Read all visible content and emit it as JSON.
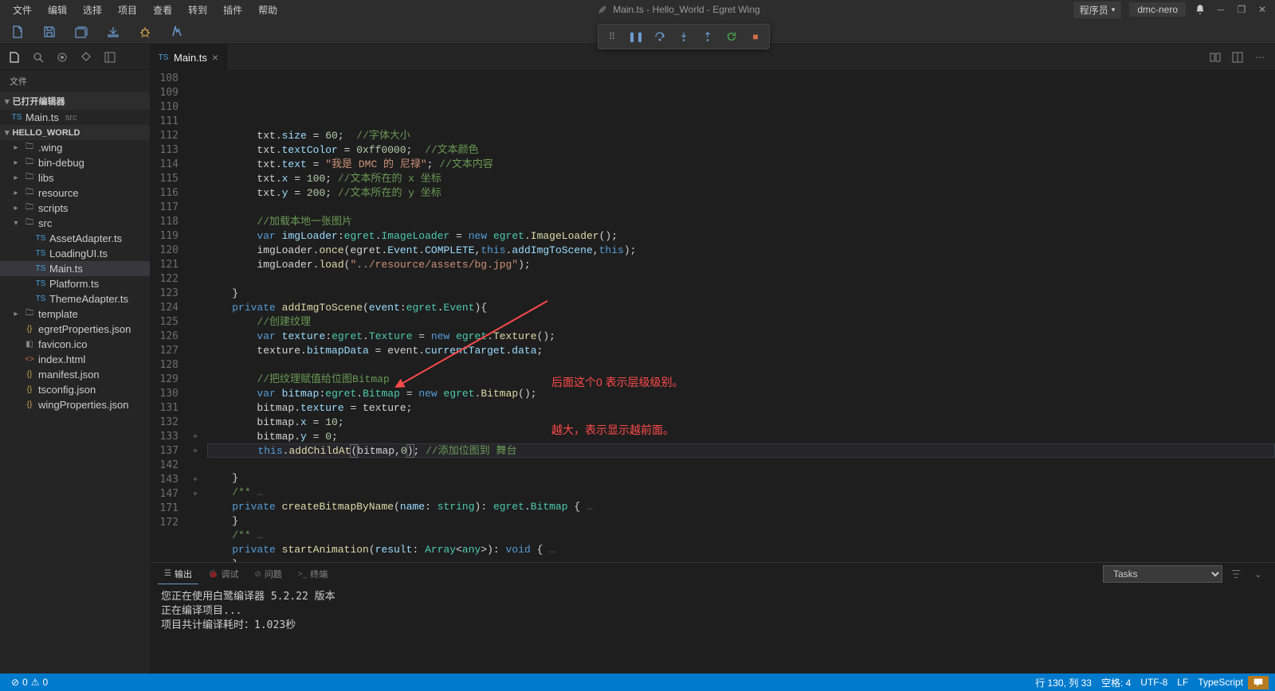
{
  "menus": [
    "文件",
    "编辑",
    "选择",
    "项目",
    "查看",
    "转到",
    "插件",
    "帮助"
  ],
  "window_title": "Main.ts - Hello_World - Egret Wing",
  "role_label": "程序员",
  "user_label": "dmc-nero",
  "sidebar": {
    "title": "文件",
    "open_editors_label": "已打开编辑器",
    "open_editors": [
      {
        "name": "Main.ts",
        "hint": "src"
      }
    ],
    "project_label": "HELLO_WORLD",
    "tree": [
      {
        "type": "folder",
        "name": ".wing",
        "depth": 1,
        "open": false
      },
      {
        "type": "folder",
        "name": "bin-debug",
        "depth": 1,
        "open": false
      },
      {
        "type": "folder",
        "name": "libs",
        "depth": 1,
        "open": false
      },
      {
        "type": "folder",
        "name": "resource",
        "depth": 1,
        "open": false
      },
      {
        "type": "folder",
        "name": "scripts",
        "depth": 1,
        "open": false
      },
      {
        "type": "folder",
        "name": "src",
        "depth": 1,
        "open": true
      },
      {
        "type": "file",
        "name": "AssetAdapter.ts",
        "depth": 2,
        "ico": "ts"
      },
      {
        "type": "file",
        "name": "LoadingUI.ts",
        "depth": 2,
        "ico": "ts"
      },
      {
        "type": "file",
        "name": "Main.ts",
        "depth": 2,
        "ico": "ts",
        "active": true
      },
      {
        "type": "file",
        "name": "Platform.ts",
        "depth": 2,
        "ico": "ts"
      },
      {
        "type": "file",
        "name": "ThemeAdapter.ts",
        "depth": 2,
        "ico": "ts"
      },
      {
        "type": "folder",
        "name": "template",
        "depth": 1,
        "open": false
      },
      {
        "type": "file",
        "name": "egretProperties.json",
        "depth": 1,
        "ico": "json"
      },
      {
        "type": "file",
        "name": "favicon.ico",
        "depth": 1,
        "ico": "ico"
      },
      {
        "type": "file",
        "name": "index.html",
        "depth": 1,
        "ico": "html"
      },
      {
        "type": "file",
        "name": "manifest.json",
        "depth": 1,
        "ico": "json"
      },
      {
        "type": "file",
        "name": "tsconfig.json",
        "depth": 1,
        "ico": "json"
      },
      {
        "type": "file",
        "name": "wingProperties.json",
        "depth": 1,
        "ico": "json"
      }
    ]
  },
  "editor_tab": {
    "name": "Main.ts"
  },
  "code": {
    "first_line": 108,
    "lines": [
      {
        "n": 108,
        "html": "        txt.<span class='tok-prop'>size</span> = <span class='tok-num'>60</span>;  <span class='tok-cm'>//字体大小</span>"
      },
      {
        "n": 109,
        "html": "        txt.<span class='tok-prop'>textColor</span> = <span class='tok-num'>0xff0000</span>;  <span class='tok-cm'>//文本颜色</span>"
      },
      {
        "n": 110,
        "html": "        txt.<span class='tok-prop'>text</span> = <span class='tok-str'>\"我是 DMC 的 尼禄\"</span>; <span class='tok-cm'>//文本内容</span>"
      },
      {
        "n": 111,
        "html": "        txt.<span class='tok-prop'>x</span> = <span class='tok-num'>100</span>; <span class='tok-cm'>//文本所在的 x 坐标</span>"
      },
      {
        "n": 112,
        "html": "        txt.<span class='tok-prop'>y</span> = <span class='tok-num'>200</span>; <span class='tok-cm'>//文本所在的 y 坐标</span>"
      },
      {
        "n": 113,
        "html": ""
      },
      {
        "n": 114,
        "html": "        <span class='tok-cm'>//加载本地一张图片</span>"
      },
      {
        "n": 115,
        "html": "        <span class='tok-kw'>var</span> <span class='tok-prop'>imgLoader</span>:<span class='tok-type'>egret</span>.<span class='tok-type'>ImageLoader</span> = <span class='tok-kw'>new</span> <span class='tok-type'>egret</span>.<span class='tok-fn'>ImageLoader</span>();"
      },
      {
        "n": 116,
        "html": "        imgLoader.<span class='tok-fn'>once</span>(egret.<span class='tok-prop'>Event</span>.<span class='tok-prop'>COMPLETE</span>,<span class='tok-kw'>this</span>.<span class='tok-prop'>addImgToScene</span>,<span class='tok-kw'>this</span>);"
      },
      {
        "n": 117,
        "html": "        imgLoader.<span class='tok-fn'>load</span>(<span class='tok-str'>\"../resource/assets/bg.jpg\"</span>);"
      },
      {
        "n": 118,
        "html": ""
      },
      {
        "n": 119,
        "html": "    }"
      },
      {
        "n": 120,
        "html": "    <span class='tok-kw'>private</span> <span class='tok-fn'>addImgToScene</span>(<span class='tok-prop'>event</span>:<span class='tok-type'>egret</span>.<span class='tok-type'>Event</span>){"
      },
      {
        "n": 121,
        "html": "        <span class='tok-cm'>//创建纹理</span>"
      },
      {
        "n": 122,
        "html": "        <span class='tok-kw'>var</span> <span class='tok-prop'>texture</span>:<span class='tok-type'>egret</span>.<span class='tok-type'>Texture</span> = <span class='tok-kw'>new</span> <span class='tok-type'>egret</span>.<span class='tok-fn'>Texture</span>();"
      },
      {
        "n": 123,
        "html": "        texture.<span class='tok-prop'>bitmapData</span> = event.<span class='tok-prop'>currentTarget</span>.<span class='tok-prop'>data</span>;"
      },
      {
        "n": 124,
        "html": ""
      },
      {
        "n": 125,
        "html": "        <span class='tok-cm'>//把纹理赋值给位图Bitmap</span>"
      },
      {
        "n": 126,
        "html": "        <span class='tok-kw'>var</span> <span class='tok-prop'>bitmap</span>:<span class='tok-type'>egret</span>.<span class='tok-type'>Bitmap</span> = <span class='tok-kw'>new</span> <span class='tok-type'>egret</span>.<span class='tok-fn'>Bitmap</span>();"
      },
      {
        "n": 127,
        "html": "        bitmap.<span class='tok-prop'>texture</span> = texture;"
      },
      {
        "n": 128,
        "html": "        bitmap.<span class='tok-prop'>x</span> = <span class='tok-num'>10</span>;"
      },
      {
        "n": 129,
        "html": "        bitmap.<span class='tok-prop'>y</span> = <span class='tok-num'>0</span>;"
      },
      {
        "n": 130,
        "hl": true,
        "html": "        <span class='tok-kw'>this</span>.<span class='tok-fn'>addChildAt</span><span class='paren-match'>(</span>bitmap,<span class='tok-num'>0</span><span class='paren-match'>)</span>; <span class='tok-cm'>//添加位图到 舞台</span>"
      },
      {
        "n": 131,
        "html": ""
      },
      {
        "n": 132,
        "html": "    }"
      },
      {
        "n": 133,
        "fold": "+",
        "html": "    <span class='tok-cm'>/**</span> <span style='color:#666'>…</span>"
      },
      {
        "n": 137,
        "fold": "+",
        "html": "    <span class='tok-kw'>private</span> <span class='tok-fn'>createBitmapByName</span>(<span class='tok-prop'>name</span>: <span class='tok-type'>string</span>): <span class='tok-type'>egret</span>.<span class='tok-type'>Bitmap</span> { <span style='color:#666'>…</span>"
      },
      {
        "n": 142,
        "html": "    }"
      },
      {
        "n": 143,
        "fold": "+",
        "html": "    <span class='tok-cm'>/**</span> <span style='color:#666'>…</span>"
      },
      {
        "n": 147,
        "fold": "+",
        "html": "    <span class='tok-kw'>private</span> <span class='tok-fn'>startAnimation</span>(<span class='tok-prop'>result</span>: <span class='tok-type'>Array</span>&lt;<span class='tok-type'>any</span>&gt;): <span class='tok-kw'>void</span> { <span style='color:#666'>…</span>"
      },
      {
        "n": 171,
        "html": "    }"
      },
      {
        "n": 172,
        "html": ""
      }
    ]
  },
  "annotation": {
    "line1": "后面这个0 表示层级级别。",
    "line2": "越大，表示显示越前面。"
  },
  "panel": {
    "tabs": [
      {
        "icon": "☰",
        "label": "输出",
        "active": true
      },
      {
        "icon": "🐞",
        "label": "调试"
      },
      {
        "icon": "⊘",
        "label": "问题"
      },
      {
        "icon": ">_",
        "label": "终端"
      }
    ],
    "select_value": "Tasks",
    "body": [
      "您正在使用白鹭编译器 5.2.22 版本",
      "正在编译项目...",
      "项目共计编译耗时：1.023秒"
    ]
  },
  "status": {
    "errors": "0",
    "warnings": "0",
    "line_col": "行 130, 列 33",
    "spaces": "空格: 4",
    "encoding": "UTF-8",
    "eol": "LF",
    "lang": "TypeScript"
  }
}
